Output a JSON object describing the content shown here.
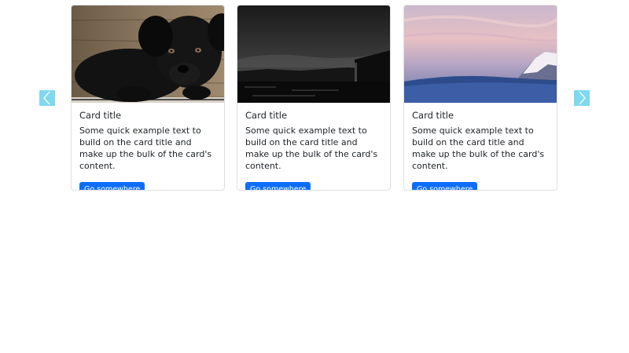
{
  "carousel": {
    "prev_icon": "chevron-left-icon",
    "next_icon": "chevron-right-icon",
    "arrow_color": "#80d8f0",
    "cards": [
      {
        "image": "black-puppy-photo",
        "title": "Card title",
        "text": "Some quick example text to build on the card title and make up the bulk of the card's content.",
        "button_label": "Go somewhere"
      },
      {
        "image": "night-barn-field-photo",
        "title": "Card title",
        "text": "Some quick example text to build on the card title and make up the bulk of the card's content.",
        "button_label": "Go somewhere"
      },
      {
        "image": "snowy-mountain-sunset-photo",
        "title": "Card title",
        "text": "Some quick example text to build on the card title and make up the bulk of the card's content.",
        "button_label": "Go somewhere"
      }
    ],
    "button_color": "#0d6efd"
  }
}
